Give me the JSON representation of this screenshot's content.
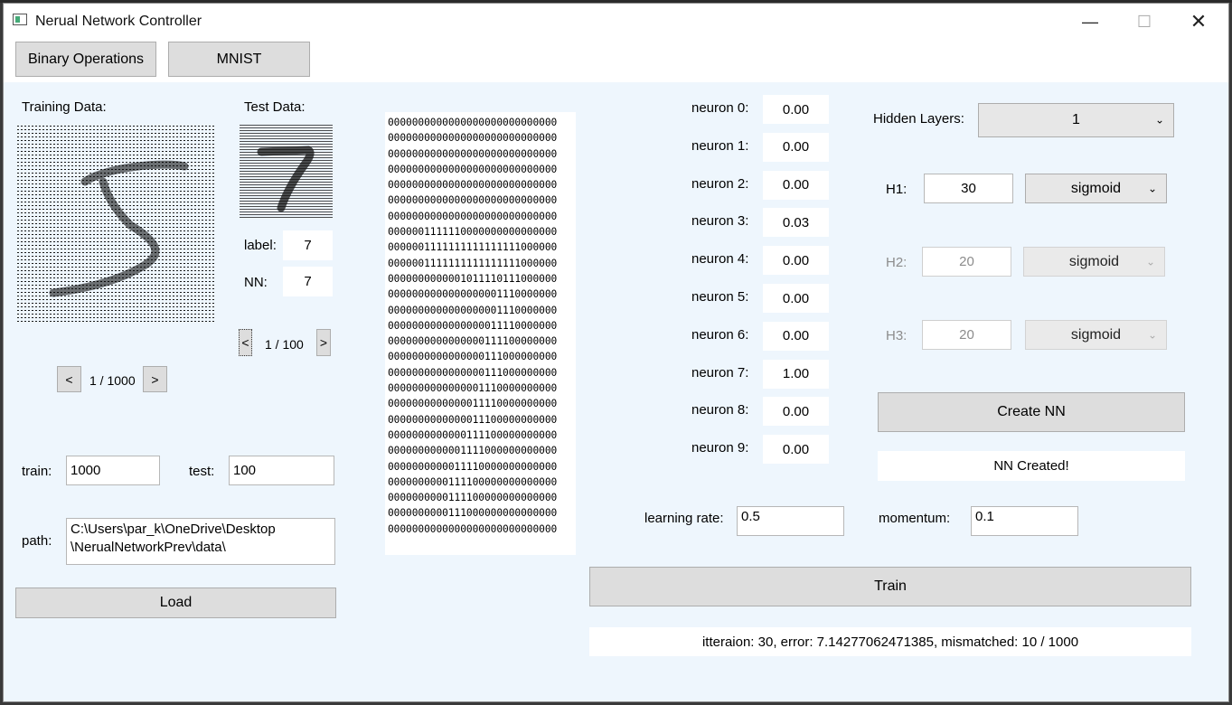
{
  "window": {
    "title": "Nerual Network Controller",
    "minimize": "—",
    "maximize": "☐",
    "close": "✕"
  },
  "tabs": {
    "binary": "Binary Operations",
    "mnist": "MNIST"
  },
  "training": {
    "title": "Training Data:",
    "pager": {
      "prev": "<",
      "next": ">",
      "text": "1 / 1000"
    }
  },
  "test": {
    "title": "Test Data:",
    "label_caption": "label:",
    "label_value": "7",
    "nn_caption": "NN:",
    "nn_value": "7",
    "pager": {
      "prev": "<",
      "next": ">",
      "text": "1 / 100"
    }
  },
  "counts": {
    "train_label": "train:",
    "train_value": "1000",
    "test_label": "test:",
    "test_value": "100"
  },
  "path": {
    "label": "path:",
    "line1": "C:\\Users\\par_k\\OneDrive\\Desktop",
    "line2": "\\NerualNetworkPrev\\data\\"
  },
  "load_button": "Load",
  "matrix": [
    "0000000000000000000000000000",
    "0000000000000000000000000000",
    "0000000000000000000000000000",
    "0000000000000000000000000000",
    "0000000000000000000000000000",
    "0000000000000000000000000000",
    "0000000000000000000000000000",
    "0000001111110000000000000000",
    "0000001111111111111111000000",
    "0000001111111111111111000000",
    "0000000000001011110111000000",
    "0000000000000000001110000000",
    "0000000000000000001110000000",
    "0000000000000000011110000000",
    "0000000000000000111100000000",
    "0000000000000000111000000000",
    "0000000000000000111000000000",
    "0000000000000001110000000000",
    "0000000000000011110000000000",
    "0000000000000011100000000000",
    "0000000000000111100000000000",
    "0000000000001111000000000000",
    "0000000000011110000000000000",
    "0000000000111100000000000000",
    "0000000000111100000000000000",
    "0000000000111000000000000000",
    "0000000000000000000000000000"
  ],
  "neurons": [
    {
      "label": "neuron 0:",
      "value": "0.00"
    },
    {
      "label": "neuron 1:",
      "value": "0.00"
    },
    {
      "label": "neuron 2:",
      "value": "0.00"
    },
    {
      "label": "neuron 3:",
      "value": "0.03"
    },
    {
      "label": "neuron 4:",
      "value": "0.00"
    },
    {
      "label": "neuron 5:",
      "value": "0.00"
    },
    {
      "label": "neuron 6:",
      "value": "0.00"
    },
    {
      "label": "neuron 7:",
      "value": "1.00"
    },
    {
      "label": "neuron 8:",
      "value": "0.00"
    },
    {
      "label": "neuron 9:",
      "value": "0.00"
    }
  ],
  "network": {
    "hidden_layers_label": "Hidden Layers:",
    "hidden_layers_value": "1",
    "h1": {
      "label": "H1:",
      "value": "30",
      "activation": "sigmoid"
    },
    "h2": {
      "label": "H2:",
      "value": "20",
      "activation": "sigmoid"
    },
    "h3": {
      "label": "H3:",
      "value": "20",
      "activation": "sigmoid"
    },
    "create_button": "Create NN",
    "create_status": "NN Created!"
  },
  "training_params": {
    "lr_label": "learning rate:",
    "lr_value": "0.5",
    "momentum_label": "momentum:",
    "momentum_value": "0.1"
  },
  "train_button": "Train",
  "status": "itteraion: 30, error: 7.14277062471385, mismatched: 10 / 1000",
  "icons": {
    "chevron": "⌄"
  }
}
